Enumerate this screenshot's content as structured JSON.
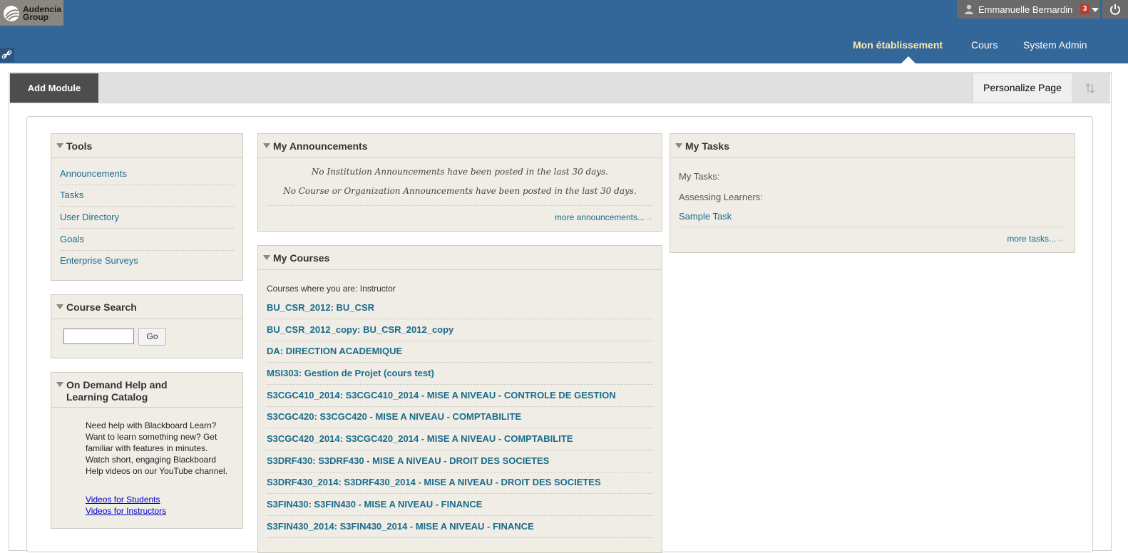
{
  "brand": {
    "logo_line1": "Audencia",
    "logo_line2": "Group"
  },
  "user": {
    "name": "Emmanuelle Bernardin",
    "notification_count": "3"
  },
  "nav": {
    "tabs": [
      "Mon établissement",
      "Cours",
      "System Admin"
    ],
    "active": "Mon établissement"
  },
  "actionbar": {
    "add_module": "Add Module",
    "personalize": "Personalize Page"
  },
  "tools": {
    "title": "Tools",
    "links": [
      "Announcements",
      "Tasks",
      "User Directory",
      "Goals",
      "Enterprise Surveys"
    ]
  },
  "course_search": {
    "title": "Course Search",
    "go_label": "Go",
    "value": ""
  },
  "help": {
    "title_line1": "On Demand Help and",
    "title_line2": "Learning Catalog",
    "body": "Need help with Blackboard Learn? Want to learn something new? Get familiar with features in minutes. Watch short, engaging Blackboard Help videos on our YouTube channel.",
    "link_students": "Videos for Students",
    "link_instructors": "Videos for Instructors"
  },
  "announcements": {
    "title": "My Announcements",
    "line1": "No Institution Announcements have been posted in the last 30 days.",
    "line2": "No Course or Organization Announcements have been posted in the last 30 days.",
    "more": "more announcements..."
  },
  "courses": {
    "title": "My Courses",
    "role_label": "Courses where you are: Instructor",
    "items": [
      "BU_CSR_2012: BU_CSR",
      "BU_CSR_2012_copy: BU_CSR_2012_copy",
      "DA: DIRECTION ACADEMIQUE",
      "MSI303: Gestion de Projet (cours test)",
      "S3CGC410_2014: S3CGC410_2014 - MISE A NIVEAU - CONTROLE DE GESTION",
      "S3CGC420: S3CGC420 - MISE A NIVEAU - COMPTABILITE",
      "S3CGC420_2014: S3CGC420_2014 - MISE A NIVEAU - COMPTABILITE",
      "S3DRF430: S3DRF430 - MISE A NIVEAU - DROIT DES SOCIETES",
      "S3DRF430_2014: S3DRF430_2014 - MISE A NIVEAU - DROIT DES SOCIETES",
      "S3FIN430: S3FIN430 - MISE A NIVEAU - FINANCE",
      "S3FIN430_2014: S3FIN430_2014 - MISE A NIVEAU - FINANCE"
    ]
  },
  "tasks": {
    "title": "My Tasks",
    "my_tasks_label": "My Tasks:",
    "assessing_label": "Assessing Learners:",
    "sample_task": "Sample Task",
    "more": "more tasks..."
  },
  "colors": {
    "header_bg": "#336699",
    "link": "#1a6c8c",
    "module_bg": "#efede6"
  }
}
